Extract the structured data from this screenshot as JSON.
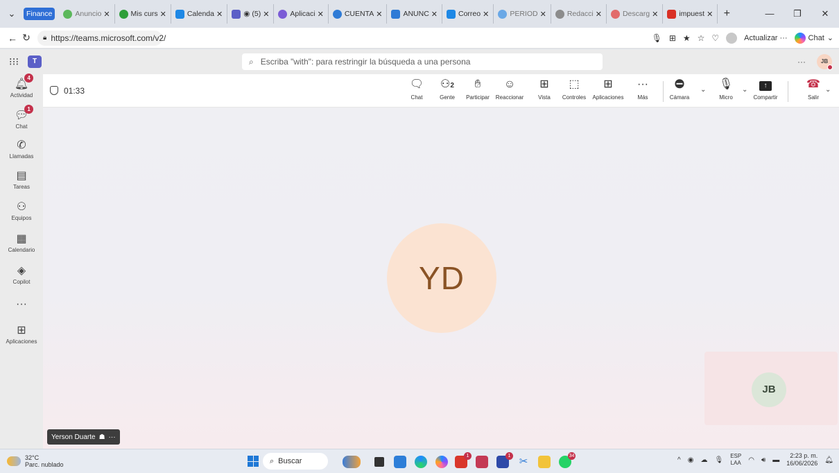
{
  "browser": {
    "tabs": [
      {
        "label": "Finance",
        "type": "group",
        "color": "#2f6fd6"
      },
      {
        "label": "Anuncio",
        "color": "#5cb85c"
      },
      {
        "label": "Mis curs",
        "color": "#2e9e3a"
      },
      {
        "label": "Calenda",
        "color": "#1e88e5"
      },
      {
        "label": "(5)",
        "color": "#5b5fc7",
        "active": true
      },
      {
        "label": "Aplicaci",
        "color": "#7b5cd6"
      },
      {
        "label": "CUENTA",
        "color": "#2f7bd6"
      },
      {
        "label": "ANUNC",
        "color": "#2f7bd6"
      },
      {
        "label": "Correo",
        "color": "#1e88e5"
      },
      {
        "label": "PERIOD",
        "color": "#6aa8e6"
      },
      {
        "label": "Redacci",
        "color": "#8c8c8c"
      },
      {
        "label": "Descarg",
        "color": "#e26b6b"
      },
      {
        "label": "impuest",
        "color": "#d93025"
      }
    ],
    "new_tab": "+",
    "url": "https://teams.microsoft.com/v2/",
    "update_label": "Actualizar",
    "more_label": "···",
    "chat_label": "Chat"
  },
  "teams": {
    "search_placeholder": "Escriba \"with\": para restringir la búsqueda a una persona",
    "more": "···",
    "user_initials": "JB",
    "rail": [
      {
        "label": "Actividad",
        "icon": "bell-icon",
        "badge": "4"
      },
      {
        "label": "Chat",
        "icon": "chat-icon",
        "badge": "1"
      },
      {
        "label": "Llamadas",
        "icon": "phone-icon"
      },
      {
        "label": "Tareas",
        "icon": "tasks-icon"
      },
      {
        "label": "Equipos",
        "icon": "teams-icon"
      },
      {
        "label": "Calendario",
        "icon": "calendar-icon"
      },
      {
        "label": "Copilot",
        "icon": "copilot-icon"
      },
      {
        "label": "···",
        "icon": "more-icon"
      },
      {
        "label": "Aplicaciones",
        "icon": "add-apps-icon"
      }
    ]
  },
  "meeting": {
    "timer": "01:33",
    "people_count": "2",
    "controls": {
      "chat": "Chat",
      "people": "Gente",
      "raise": "Participar",
      "react": "Reaccionar",
      "view": "Vista",
      "controls": "Controles",
      "apps": "Aplicaciones",
      "more": "Más",
      "camera": "Cámara",
      "mic": "Micro",
      "share": "Compartir",
      "leave": "Salir"
    },
    "main_participant_initials": "YD",
    "main_participant_name": "Yerson Duarte",
    "self_initials": "JB"
  },
  "taskbar": {
    "temperature": "32°C",
    "weather": "Parc. nublado",
    "search_label": "Buscar",
    "lang_top": "ESP",
    "lang_bottom": "LAA",
    "time": "2:23 p. m.",
    "date": "16/06/2026",
    "whatsapp_badge": "34"
  }
}
